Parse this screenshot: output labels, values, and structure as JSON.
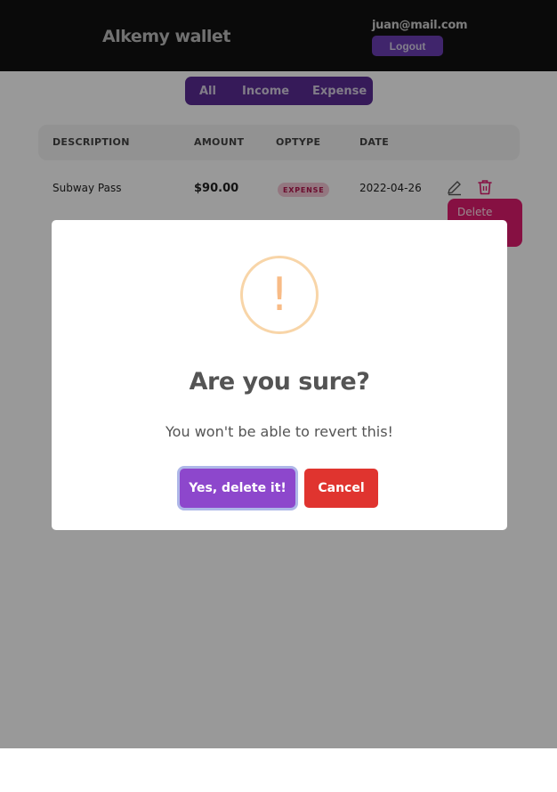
{
  "header": {
    "brand": "Alkemy wallet",
    "user_email": "juan@mail.com",
    "logout_label": "Logout"
  },
  "filter": {
    "tabs": [
      "All",
      "Income",
      "Expense"
    ]
  },
  "table": {
    "columns": [
      "DESCRIPTION",
      "AMOUNT",
      "OPTYPE",
      "DATE"
    ],
    "rows": [
      {
        "description": "Subway Pass",
        "amount": "$90.00",
        "optype": "EXPENSE",
        "date": "2022-04-26"
      }
    ]
  },
  "tooltip": {
    "text": "Delete"
  },
  "dialog": {
    "icon": "warning-icon",
    "icon_glyph": "!",
    "title": "Are you sure?",
    "text": "You won't be able to revert this!",
    "confirm_label": "Yes, delete it!",
    "cancel_label": "Cancel"
  },
  "colors": {
    "header_bg": "#111111",
    "accent_purple": "#8d47cc",
    "cancel_red": "#e0342f",
    "tooltip_pink": "#e01c6e",
    "warning_orange": "#f8bb86"
  }
}
